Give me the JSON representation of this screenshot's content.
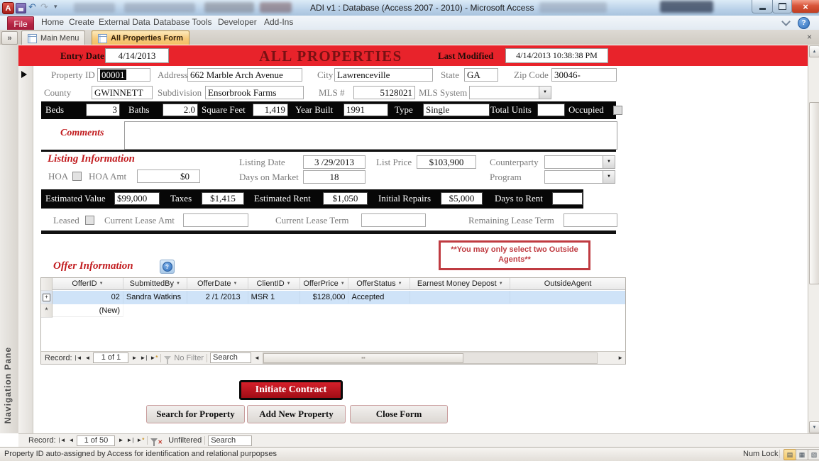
{
  "titlebar": {
    "title": "ADI v1 : Database (Access 2007 - 2010) - Microsoft Access",
    "logo_letter": "A"
  },
  "ribbon": {
    "tabs": [
      "File",
      "Home",
      "Create",
      "External Data",
      "Database Tools",
      "Developer",
      "Add-Ins"
    ]
  },
  "doc_tabs": {
    "shutter": "»",
    "main_menu": "Main Menu",
    "all_properties": "All Properties Form"
  },
  "nav_pane": {
    "label": "Navigation Pane"
  },
  "header": {
    "entry_date_label": "Entry Date",
    "entry_date": "4/14/2013",
    "title": "ALL PROPERTIES",
    "last_modified_label": "Last Modified",
    "last_modified": "4/14/2013 10:38:38 PM"
  },
  "property": {
    "property_id_label": "Property ID",
    "property_id": "00001",
    "address_label": "Address",
    "address": "662 Marble Arch Avenue",
    "city_label": "City",
    "city": "Lawrenceville",
    "state_label": "State",
    "state": "GA",
    "zip_label": "Zip Code",
    "zip": "30046-",
    "county_label": "County",
    "county": "GWINNETT",
    "subdivision_label": "Subdivision",
    "subdivision": "Ensorbrook Farms",
    "mls_label": "MLS #",
    "mls": "5128021",
    "mls_system_label": "MLS System",
    "mls_system": ""
  },
  "specs": {
    "beds_label": "Beds",
    "beds": "3",
    "baths_label": "Baths",
    "baths": "2.0",
    "sqft_label": "Square Feet",
    "sqft": "1,419",
    "year_label": "Year Built",
    "year": "1991",
    "type_label": "Type",
    "type": "Single",
    "units_label": "Total Units",
    "units": "",
    "occupied_label": "Occupied"
  },
  "comments": {
    "label": "Comments",
    "value": ""
  },
  "listing": {
    "heading": "Listing Information",
    "hoa_label": "HOA",
    "hoa_amt_label": "HOA Amt",
    "hoa_amt": "$0",
    "listing_date_label": "Listing Date",
    "listing_date": "3 /29/2013",
    "days_on_market_label": "Days on Market",
    "days_on_market": "18",
    "list_price_label": "List Price",
    "list_price": "$103,900",
    "counterparty_label": "Counterparty",
    "counterparty": "",
    "program_label": "Program",
    "program": ""
  },
  "financials": {
    "est_value_label": "Estimated Value",
    "est_value": "$99,000",
    "taxes_label": "Taxes",
    "taxes": "$1,415",
    "est_rent_label": "Estimated Rent",
    "est_rent": "$1,050",
    "repairs_label": "Initial Repairs",
    "repairs": "$5,000",
    "days_to_rent_label": "Days to Rent",
    "days_to_rent": ""
  },
  "lease": {
    "leased_label": "Leased",
    "current_amt_label": "Current Lease Amt",
    "current_amt": "",
    "current_term_label": "Current Lease Term",
    "current_term": "",
    "remaining_term_label": "Remaining Lease Term",
    "remaining_term": ""
  },
  "offers": {
    "heading": "Offer Information",
    "warning_line1": "**You may only select two Outside",
    "warning_line2": "Agents**",
    "columns": [
      "OfferID",
      "SubmittedBy",
      "OfferDate",
      "ClientID",
      "OfferPrice",
      "OfferStatus",
      "Earnest Money Depost",
      "OutsideAgent"
    ],
    "rows": [
      [
        "02",
        "Sandra Watkins",
        "2 /1 /2013",
        "MSR 1",
        "$128,000",
        "Accepted",
        "",
        ""
      ]
    ],
    "new_row_label": "(New)",
    "nav": {
      "record_label": "Record:",
      "position": "1 of 1",
      "filter": "No Filter",
      "search": "Search"
    }
  },
  "buttons": {
    "initiate": "Initiate Contract",
    "search": "Search for Property",
    "add": "Add New Property",
    "close": "Close Form"
  },
  "main_nav": {
    "record_label": "Record:",
    "position": "1 of 50",
    "filter": "Unfiltered",
    "search": "Search"
  },
  "status_bar": {
    "message": "Property ID auto-assigned by Access for identification and relational purpopses",
    "num_lock": "Num Lock"
  },
  "icons": {
    "undo": "↶",
    "redo": "↷",
    "qat_dropdown": "▾",
    "help": "?",
    "close_x": "×",
    "sort": "▼",
    "combo": "▼",
    "up": "▲",
    "down": "▼",
    "prev": "◄",
    "next": "►",
    "first": "|◄",
    "last": "►|",
    "expand": "+",
    "new_marker": "*",
    "grip": "▪▪",
    "min_glyph": "—",
    "x_mark": "✕"
  },
  "colors": {
    "accent_red": "#e8232b",
    "file_tab_red": "#b32343",
    "active_tab_orange": "#f6c978",
    "selection_blue": "#cfe3f8",
    "button_red": "#c01823",
    "black_bar": "#070707"
  }
}
